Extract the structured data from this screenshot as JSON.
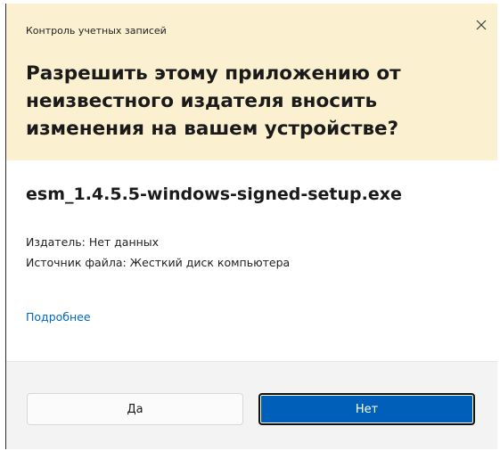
{
  "window": {
    "title": "Контроль учетных записей",
    "question": "Разрешить этому приложению от неизвестного издателя вносить изменения на вашем устройстве?"
  },
  "app": {
    "file_name": "esm_1.4.5.5-windows-signed-setup.exe",
    "publisher_line": "Издатель: Нет данных",
    "source_line": "Источник файла: Жесткий диск компьютера"
  },
  "links": {
    "more_details": "Подробнее"
  },
  "buttons": {
    "yes_label": "Да",
    "no_label": "Нет"
  },
  "icons": {
    "close": "close-icon"
  },
  "colors": {
    "header_background": "#fbf0cf",
    "accent": "#005fb8",
    "link": "#0067c0",
    "footer_background": "#f3f3f3"
  }
}
